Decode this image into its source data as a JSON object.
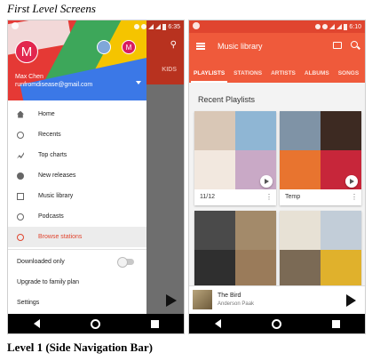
{
  "doc": {
    "title": "First Level Screens",
    "caption": "Level 1 (Side Navigation Bar)"
  },
  "status": {
    "time_left": "6:35",
    "time_right": "6:10"
  },
  "left": {
    "background_tab": "KIDS",
    "account": {
      "initial": "M",
      "alt_initial": "M",
      "name": "Max Chen",
      "email": "runfromdisease@gmail.com"
    },
    "menu": [
      {
        "label": "Home",
        "icon": "home-icon"
      },
      {
        "label": "Recents",
        "icon": "recents-icon"
      },
      {
        "label": "Top charts",
        "icon": "top-charts-icon"
      },
      {
        "label": "New releases",
        "icon": "new-releases-icon"
      },
      {
        "label": "Music library",
        "icon": "music-library-icon"
      },
      {
        "label": "Podcasts",
        "icon": "podcasts-icon"
      },
      {
        "label": "Browse stations",
        "icon": "radio-icon",
        "active": true
      }
    ],
    "downloaded_only": "Downloaded only",
    "upgrade": "Upgrade to family plan",
    "settings": "Settings"
  },
  "right": {
    "app_title": "Music library",
    "tabs": [
      "PLAYLISTS",
      "STATIONS",
      "ARTISTS",
      "ALBUMS",
      "SONGS"
    ],
    "section_title": "Recent Playlists",
    "cards": [
      {
        "title": "11/12",
        "colors": [
          "#d9c7b6",
          "#8fb6d4",
          "#f2e8df",
          "#c9a9c6"
        ]
      },
      {
        "title": "Temp",
        "colors": [
          "#7f93a6",
          "#3d2a22",
          "#e8742f",
          "#c7263a"
        ]
      },
      {
        "title": "",
        "colors": [
          "#4a4a4a",
          "#a38a6a",
          "#2f2f2f",
          "#9a7b5a"
        ]
      },
      {
        "title": "",
        "colors": [
          "#e7e1d5",
          "#c2cdd8",
          "#7b6a55",
          "#e0b12c"
        ]
      }
    ],
    "now_playing": {
      "title": "The Bird",
      "artist": "Anderson Paak"
    }
  },
  "colors": {
    "accent": "#ef5a3b",
    "accent_dark": "#e0452f",
    "drawer_active": "#e0452f"
  }
}
